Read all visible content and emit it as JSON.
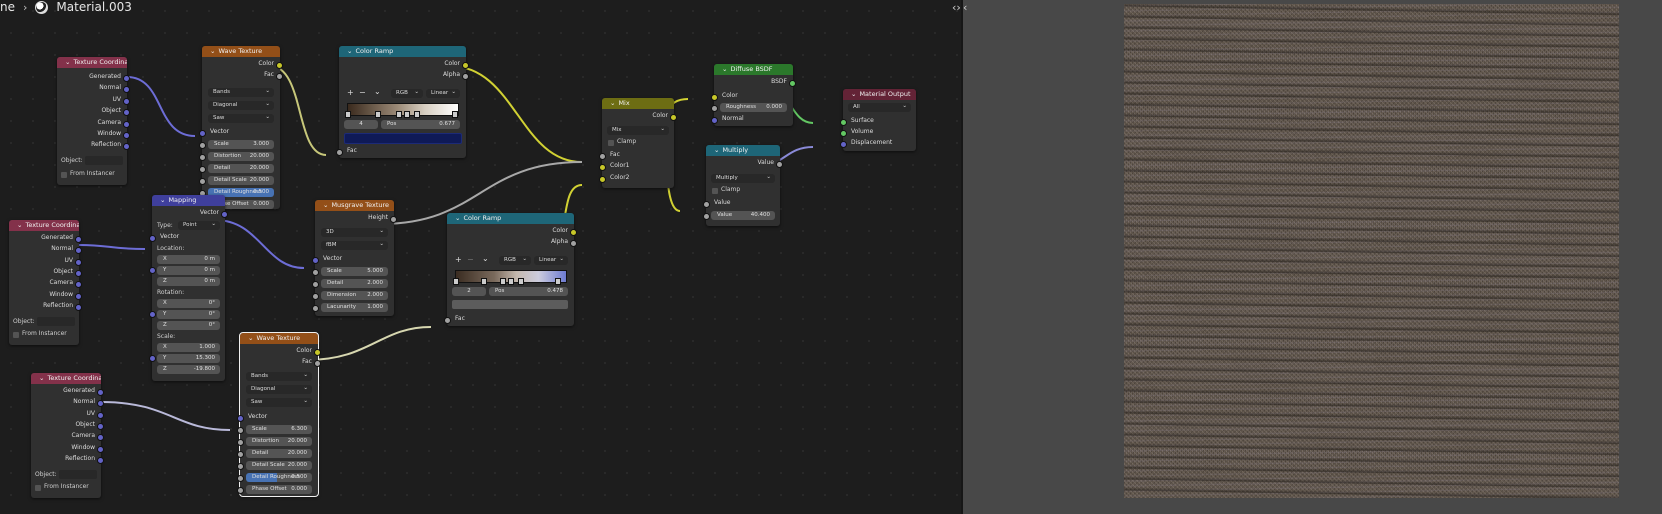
{
  "breadcrumb": {
    "root_partial": "ne",
    "material": "Material.003"
  },
  "panel": {
    "collapse": "‹›",
    "expand": "‹"
  },
  "texcoord": {
    "title": "Texture Coordinate",
    "outputs": [
      "Generated",
      "Normal",
      "UV",
      "Object",
      "Camera",
      "Window",
      "Reflection"
    ],
    "object_label": "Object:",
    "from_instancer": "From Instancer"
  },
  "wave1": {
    "title": "Wave Texture",
    "outputs": [
      "Color",
      "Fac"
    ],
    "drops": [
      "Bands",
      "Diagonal",
      "Saw"
    ],
    "vector": "Vector",
    "fields": [
      {
        "l": "Scale",
        "v": "3.000"
      },
      {
        "l": "Distortion",
        "v": "20.000"
      },
      {
        "l": "Detail",
        "v": "20.000"
      },
      {
        "l": "Detail Scale",
        "v": "20.000"
      },
      {
        "l": "Detail Roughness",
        "v": "0.500"
      },
      {
        "l": "Phase Offset",
        "v": "0.000"
      }
    ]
  },
  "ramp1": {
    "title": "Color Ramp",
    "outputs": [
      "Color",
      "Alpha"
    ],
    "mode": "RGB",
    "interp": "Linear",
    "index": "4",
    "pos_label": "Pos",
    "pos": "0.677",
    "fac": "Fac",
    "swatch": "#0f1a57"
  },
  "mapping": {
    "title": "Mapping",
    "output": "Vector",
    "type_label": "Type:",
    "type_value": "Point",
    "vector": "Vector",
    "location": "Location:",
    "loc": [
      {
        "l": "X",
        "v": "0 m"
      },
      {
        "l": "Y",
        "v": "0 m"
      },
      {
        "l": "Z",
        "v": "0 m"
      }
    ],
    "rotation": "Rotation:",
    "rot": [
      {
        "l": "X",
        "v": "0°"
      },
      {
        "l": "Y",
        "v": "0°"
      },
      {
        "l": "Z",
        "v": "0°"
      }
    ],
    "scale": "Scale:",
    "scl": [
      {
        "l": "X",
        "v": "1.000"
      },
      {
        "l": "Y",
        "v": "15.300"
      },
      {
        "l": "Z",
        "v": "-19.800"
      }
    ]
  },
  "musgrave": {
    "title": "Musgrave Texture",
    "output": "Height",
    "drops": [
      "3D",
      "fBM"
    ],
    "vector": "Vector",
    "fields": [
      {
        "l": "Scale",
        "v": "5.000"
      },
      {
        "l": "Detail",
        "v": "2.000"
      },
      {
        "l": "Dimension",
        "v": "2.000"
      },
      {
        "l": "Lacunarity",
        "v": "1.000"
      }
    ]
  },
  "ramp2": {
    "title": "Color Ramp",
    "outputs": [
      "Color",
      "Alpha"
    ],
    "mode": "RGB",
    "interp": "Linear",
    "index": "2",
    "pos_label": "Pos",
    "pos": "0.478",
    "fac": "Fac",
    "swatch": "#5c5c5c"
  },
  "wave2": {
    "title": "Wave Texture",
    "outputs": [
      "Color",
      "Fac"
    ],
    "drops": [
      "Bands",
      "Diagonal",
      "Saw"
    ],
    "vector": "Vector",
    "fields": [
      {
        "l": "Scale",
        "v": "6.300"
      },
      {
        "l": "Distortion",
        "v": "20.000"
      },
      {
        "l": "Detail",
        "v": "20.000"
      },
      {
        "l": "Detail Scale",
        "v": "20.000"
      },
      {
        "l": "Detail Roughness",
        "v": "0.500"
      },
      {
        "l": "Phase Offset",
        "v": "0.000"
      }
    ]
  },
  "mix": {
    "title": "Mix",
    "output": "Color",
    "blend": "Mix",
    "clamp": "Clamp",
    "inputs": [
      "Fac",
      "Color1",
      "Color2"
    ]
  },
  "diffuse": {
    "title": "Diffuse BSDF",
    "output": "BSDF",
    "color": "Color",
    "roughness_label": "Roughness",
    "roughness": "0.000",
    "normal": "Normal"
  },
  "multiply": {
    "title": "Multiply",
    "output": "Value",
    "op": "Multiply",
    "clamp": "Clamp",
    "value_in": "Value",
    "value_label": "Value",
    "value": "40.400"
  },
  "matout": {
    "title": "Material Output",
    "target": "All",
    "inputs": [
      "Surface",
      "Volume",
      "Displacement"
    ]
  },
  "colors": {
    "vector_socket": "#6363c7",
    "color_socket": "#c7c729",
    "float_socket": "#a1a1a1",
    "shader_socket": "#63c763",
    "link_gray": "#a8a8a8"
  }
}
